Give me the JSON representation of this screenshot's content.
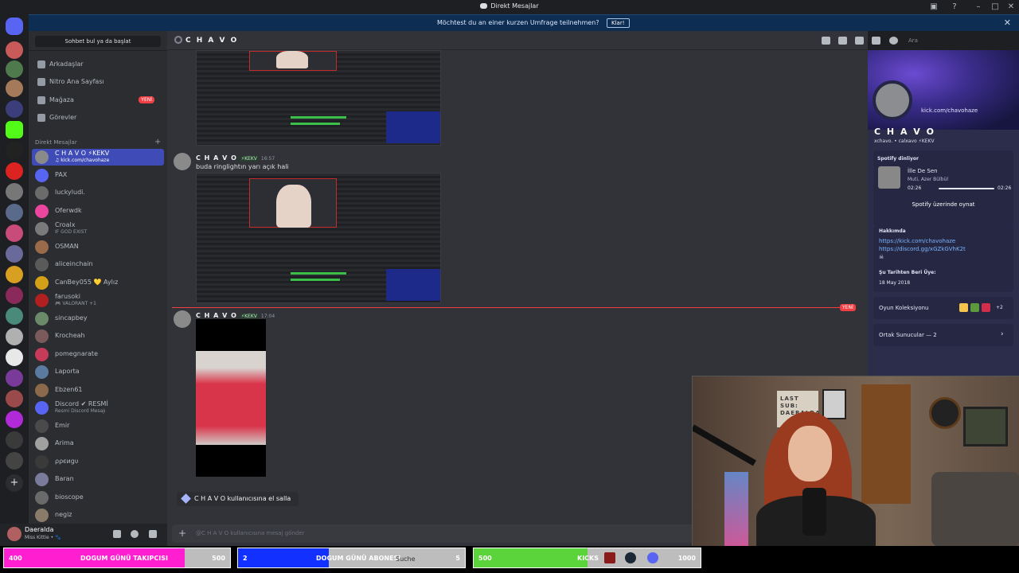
{
  "window": {
    "title": "Direkt Mesajlar"
  },
  "banner": {
    "message": "Möchtest du an einer kurzen Umfrage teilnehmen?",
    "button": "Klar!",
    "close": "✕"
  },
  "sidebar": {
    "search_label": "Sohbet bul ya da başlat",
    "nav": [
      {
        "label": "Arkadaşlar"
      },
      {
        "label": "Nitro Ana Sayfası"
      },
      {
        "label": "Mağaza",
        "badge": "YENİ"
      },
      {
        "label": "Görevler"
      }
    ],
    "dm_header": "Direkt Mesajlar",
    "dm_add": "+",
    "dms": [
      {
        "name": "C H A V O ⚡KEKV",
        "sub": "♫ kick.com/chavohaze",
        "selected": true
      },
      {
        "name": "PAX",
        "sub": ""
      },
      {
        "name": "luckyludi.",
        "sub": ""
      },
      {
        "name": "Oferwdk",
        "sub": ""
      },
      {
        "name": "Croalx",
        "sub": "IF GOD EXIST"
      },
      {
        "name": "OSMAN",
        "sub": ""
      },
      {
        "name": "aliceinchain",
        "sub": ""
      },
      {
        "name": "CanBey055 💛 Aylız",
        "sub": ""
      },
      {
        "name": "farusoki",
        "sub": "🎮 VALORANT +1"
      },
      {
        "name": "sincapbey",
        "sub": ""
      },
      {
        "name": "Krocheah",
        "sub": ""
      },
      {
        "name": "pomegnarate",
        "sub": ""
      },
      {
        "name": "Laporta",
        "sub": ""
      },
      {
        "name": "Ebzen61",
        "sub": ""
      },
      {
        "name": "Discord ✔ RESMİ",
        "sub": "Resmi Discord Mesajı"
      },
      {
        "name": "Emir",
        "sub": ""
      },
      {
        "name": "Arima",
        "sub": ""
      },
      {
        "name": "ρρєиgυ",
        "sub": ""
      },
      {
        "name": "Baran",
        "sub": ""
      },
      {
        "name": "bioscope",
        "sub": ""
      },
      {
        "name": "negiz",
        "sub": ""
      }
    ]
  },
  "user": {
    "name": "Daeralda",
    "status": "Miss Kittie • 🐾"
  },
  "chat": {
    "channel": "C H A V O",
    "search_placeholder": "Ara",
    "messages": [
      {
        "author": "C H A V O",
        "tag": "⚡KEKV",
        "time": "16:57",
        "text": "buda ringlightın yarı açık hali"
      },
      {
        "author": "C H A V O",
        "tag": "⚡KEKV",
        "time": "17:04",
        "text": ""
      }
    ],
    "new_label": "YENİ",
    "wave": "C H A V O kullanıcısına el salla",
    "composer_placeholder": "@C H A V O kullanıcısına mesaj gönder"
  },
  "profile": {
    "link_title": "kick.com/chavohaze",
    "name": "C H A V O",
    "handle": "xchavo. • calxavo  ⚡KEKV",
    "spotify_label": "Spotify dinliyor",
    "song": "İlle De Sen",
    "artist": "Muti, Azer Bülbül",
    "elapsed": "02:26",
    "duration": "02:26",
    "progress": 1.0,
    "spotify_button": "Spotify üzerinde oynat",
    "about_label": "Hakkımda",
    "links": [
      "https://kick.com/chavohaze",
      "https://discord.gg/xGZkGVhK2t"
    ],
    "member_since_label": "Şu Tarihten Beri Üye:",
    "member_since": "18 May 2018",
    "games_label": "Oyun Koleksiyonu",
    "games_more": "+2",
    "mutual_servers": "Ortak Sunucular — 2"
  },
  "webcam": {
    "sign": "LAST SUB: DAERALDA"
  },
  "overlay": {
    "goals": [
      {
        "current": "400",
        "title": "DOGUM GÜNÜ TAKIPCISI",
        "target": "500",
        "fraction": 0.8,
        "color": "#ff1fd0"
      },
      {
        "current": "2",
        "title": "DOGUM GÜNÜ ABONESI",
        "target": "5",
        "fraction": 0.4,
        "color": "#1230ff"
      },
      {
        "current": "500",
        "title": "KICKS",
        "target": "1000",
        "fraction": 0.5,
        "color": "#5ad43a"
      }
    ],
    "taskbar_search": "Suche"
  },
  "colors": {
    "accent": "#5865f2",
    "danger": "#f23f43"
  }
}
